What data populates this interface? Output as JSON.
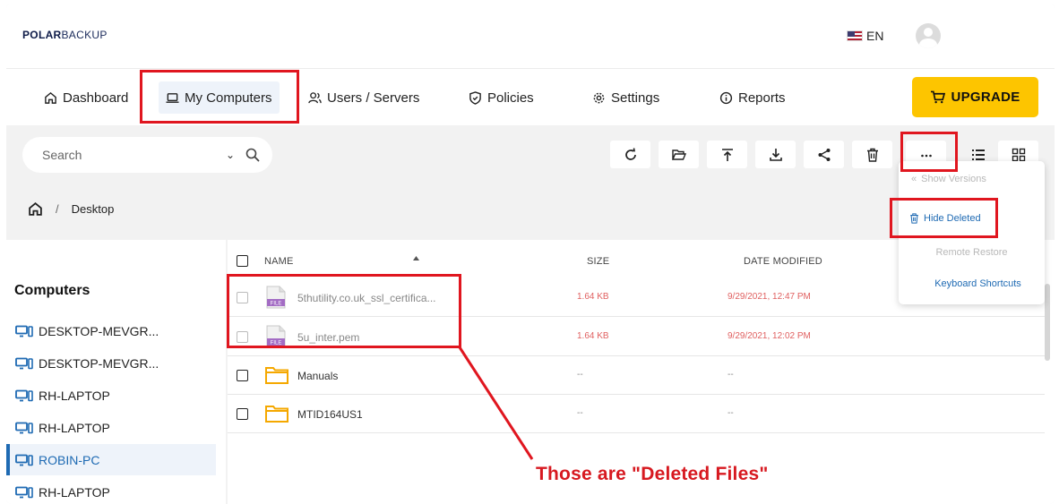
{
  "app": {
    "logo_bold": "POLAR",
    "logo_light": "BACKUP",
    "language": "EN"
  },
  "nav": {
    "items": [
      {
        "label": "Dashboard",
        "icon": "home-icon"
      },
      {
        "label": "My Computers",
        "icon": "laptop-icon",
        "active": true
      },
      {
        "label": "Users / Servers",
        "icon": "users-icon"
      },
      {
        "label": "Policies",
        "icon": "shield-icon"
      },
      {
        "label": "Settings",
        "icon": "gear-icon"
      },
      {
        "label": "Reports",
        "icon": "info-icon"
      }
    ],
    "upgrade_label": "UPGRADE"
  },
  "toolbar": {
    "search_placeholder": "Search",
    "more_label": "...",
    "buttons": [
      "refresh-icon",
      "open-folder-icon",
      "upload-icon",
      "download-icon",
      "share-icon",
      "trash-icon",
      "more-icon",
      "list-view-icon",
      "grid-view-icon"
    ]
  },
  "breadcrumb": {
    "separator": "/",
    "current": "Desktop"
  },
  "sidebar": {
    "title": "Computers",
    "computers": [
      {
        "label": "DESKTOP-MEVGR..."
      },
      {
        "label": "DESKTOP-MEVGR..."
      },
      {
        "label": "RH-LAPTOP"
      },
      {
        "label": "RH-LAPTOP"
      },
      {
        "label": "ROBIN-PC",
        "selected": true
      },
      {
        "label": "RH-LAPTOP"
      }
    ]
  },
  "table": {
    "headers": {
      "name": "NAME",
      "size": "SIZE",
      "date": "DATE MODIFIED"
    },
    "rows": [
      {
        "name": "5thutility.co.uk_ssl_certifica...",
        "size": "1.64 KB",
        "date": "9/29/2021, 12:47 PM",
        "type": "file",
        "deleted": true
      },
      {
        "name": "5u_inter.pem",
        "size": "1.64 KB",
        "date": "9/29/2021, 12:02 PM",
        "type": "file",
        "deleted": true
      },
      {
        "name": "Manuals",
        "size": "--",
        "date": "--",
        "type": "folder",
        "deleted": false
      },
      {
        "name": "MTID164US1",
        "size": "--",
        "date": "--",
        "type": "folder",
        "deleted": false
      }
    ],
    "file_badge": "FILE"
  },
  "more_menu": {
    "show_versions": "Show Versions",
    "hide_deleted": "Hide Deleted",
    "remote_restore": "Remote Restore",
    "keyboard_shortcuts": "Keyboard Shortcuts"
  },
  "annotation": {
    "text": "Those are \"Deleted Files\"",
    "color": "#e0161f"
  },
  "colors": {
    "accent": "#1e6ab3",
    "upgrade": "#fdc500",
    "deleted_text": "#e06060"
  }
}
